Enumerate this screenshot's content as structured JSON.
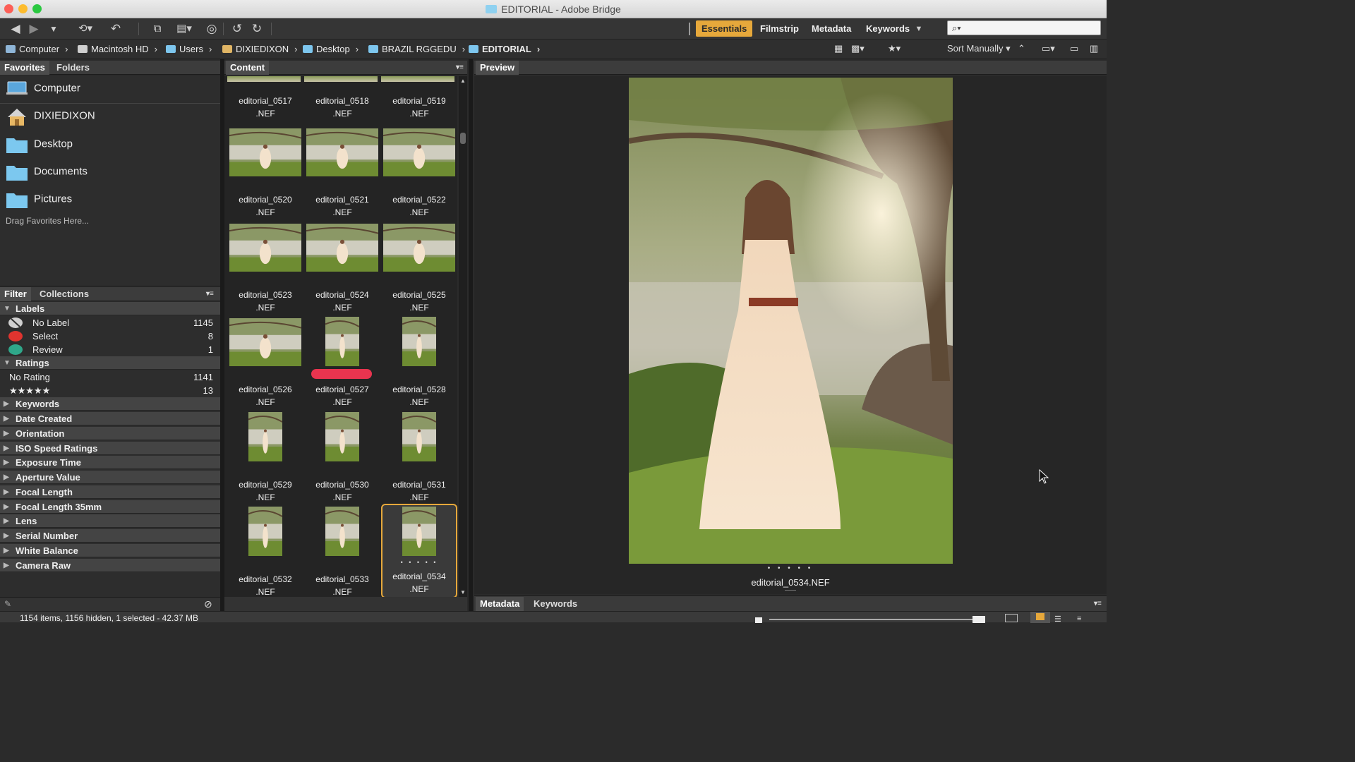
{
  "window": {
    "title": "EDITORIAL - Adobe Bridge"
  },
  "toolbar": {
    "workspaces": [
      "Essentials",
      "Filmstrip",
      "Metadata",
      "Keywords"
    ],
    "active_workspace": "Essentials",
    "search_placeholder": "⌕▾",
    "icons": [
      "back-icon",
      "forward-icon",
      "history-dropdown-icon",
      "reveal-recent-icon",
      "return-to-photoshop-icon",
      "get-photos-icon",
      "refine-icon",
      "open-in-camera-raw-icon",
      "rotate-left-icon",
      "rotate-right-icon"
    ]
  },
  "path": {
    "crumbs": [
      "Computer",
      "Macintosh HD",
      "Users",
      "DIXIEDIXON",
      "Desktop",
      "BRAZIL RGGEDU",
      "EDITORIAL"
    ],
    "sort_label": "Sort Manually"
  },
  "favorites": {
    "tabs": [
      "Favorites",
      "Folders"
    ],
    "items": [
      "Computer",
      "DIXIEDIXON",
      "Desktop",
      "Documents",
      "Pictures"
    ],
    "hint": "Drag Favorites Here..."
  },
  "filter": {
    "tabs": [
      "Filter",
      "Collections"
    ],
    "labels_header": "Labels",
    "labels": [
      {
        "name": "No Label",
        "count": "1145",
        "color": "#d0d0d0"
      },
      {
        "name": "Select",
        "count": "8",
        "color": "#e0342f"
      },
      {
        "name": "Review",
        "count": "1",
        "color": "#2fa78a"
      }
    ],
    "ratings_header": "Ratings",
    "ratings": [
      {
        "name": "No Rating",
        "count": "1141"
      },
      {
        "name": "★★★★★",
        "count": "13"
      }
    ],
    "sections": [
      "Keywords",
      "Date Created",
      "Orientation",
      "ISO Speed Ratings",
      "Exposure Time",
      "Aperture Value",
      "Focal Length",
      "Focal Length 35mm",
      "Lens",
      "Serial Number",
      "White Balance",
      "Camera Raw"
    ]
  },
  "content": {
    "tab": "Content",
    "top_row": [
      "editorial_0517",
      "editorial_0518",
      "editorial_0519"
    ],
    "ext": ".NEF",
    "rows": [
      [
        {
          "name": "editorial_0520",
          "orient": "landscape"
        },
        {
          "name": "editorial_0521",
          "orient": "landscape"
        },
        {
          "name": "editorial_0522",
          "orient": "landscape"
        }
      ],
      [
        {
          "name": "editorial_0523",
          "orient": "landscape"
        },
        {
          "name": "editorial_0524",
          "orient": "landscape"
        },
        {
          "name": "editorial_0525",
          "orient": "landscape"
        }
      ],
      [
        {
          "name": "editorial_0526",
          "orient": "landscape"
        },
        {
          "name": "editorial_0527",
          "orient": "portrait",
          "label": "select"
        },
        {
          "name": "editorial_0528",
          "orient": "portrait"
        }
      ],
      [
        {
          "name": "editorial_0529",
          "orient": "portrait"
        },
        {
          "name": "editorial_0530",
          "orient": "portrait"
        },
        {
          "name": "editorial_0531",
          "orient": "portrait"
        }
      ],
      [
        {
          "name": "editorial_0532",
          "orient": "portrait"
        },
        {
          "name": "editorial_0533",
          "orient": "portrait"
        },
        {
          "name": "editorial_0534",
          "orient": "portrait",
          "selected": true
        }
      ]
    ]
  },
  "preview": {
    "tab": "Preview",
    "filename": "editorial_0534.NEF",
    "dots": "• • • • •"
  },
  "bottom_tabs": [
    "Metadata",
    "Keywords"
  ],
  "status": {
    "text": "1154 items, 1156 hidden, 1 selected - 42.37 MB"
  },
  "colors": {
    "accent": "#e6a83b",
    "select_label": "#e8344f"
  }
}
